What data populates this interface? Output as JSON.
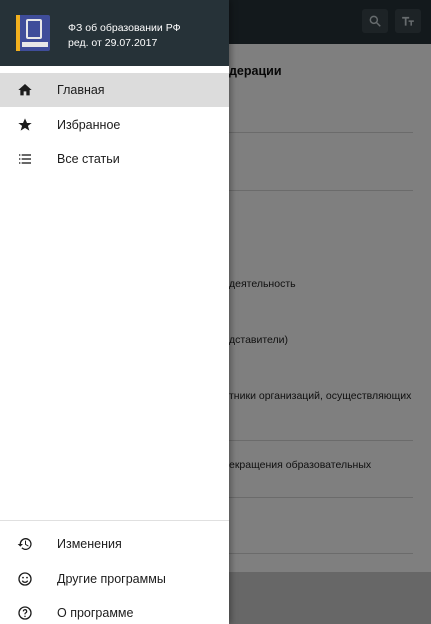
{
  "drawer": {
    "title": "ФЗ об образовании РФ",
    "subtitle": "ред. от 29.07.2017",
    "menu": [
      {
        "label": "Главная",
        "icon": "home-icon"
      },
      {
        "label": "Избранное",
        "icon": "star-icon"
      },
      {
        "label": "Все статьи",
        "icon": "list-icon"
      }
    ],
    "footer_menu": [
      {
        "label": "Изменения",
        "icon": "history-icon"
      },
      {
        "label": "Другие программы",
        "icon": "smiley-icon"
      },
      {
        "label": "О программе",
        "icon": "help-icon"
      }
    ]
  },
  "background": {
    "title_fragment": "дерации",
    "lines": [
      "деятельность",
      "дставители)",
      "тники организаций, осуществляющих",
      "екращения образовательных"
    ]
  },
  "colors": {
    "header_bg": "#263238",
    "active_item_bg": "#dcdcdc",
    "icon_color": "#1c1c1c"
  }
}
